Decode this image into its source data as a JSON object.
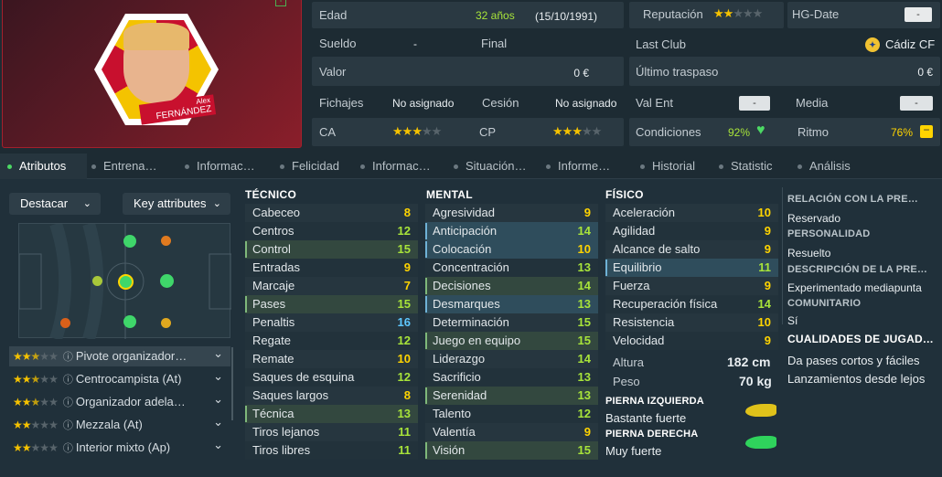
{
  "player": {
    "name_top": "Alex",
    "name_bottom": "FERNÁNDEZ"
  },
  "info": {
    "edad_label": "Edad",
    "edad_value": "32 años",
    "dob": "(15/10/1991)",
    "sueldo_label": "Sueldo",
    "sueldo_value": "-",
    "final_label": "Final",
    "valor_label": "Valor",
    "valor_value": "0 €",
    "fichajes_label": "Fichajes",
    "fichajes_value": "No asignado",
    "cesion_label": "Cesión",
    "cesion_value": "No asignado",
    "ca_label": "CA",
    "cp_label": "CP",
    "ca_stars": 3,
    "cp_stars": 3,
    "reputacion_label": "Reputación",
    "reputacion_stars": 2,
    "hgdate_label": "HG-Date",
    "hgdate_value": "-",
    "lastclub_label": "Last Club",
    "lastclub_value": "Cádiz CF",
    "traspaso_label": "Último traspaso",
    "traspaso_value": "0 €",
    "valent_label": "Val Ent",
    "valent_value": "-",
    "media_label": "Media",
    "media_value": "-",
    "condiciones_label": "Condiciones",
    "condiciones_value": "92%",
    "ritmo_label": "Ritmo",
    "ritmo_value": "76%"
  },
  "tabs": [
    "Atributos",
    "Entrena…",
    "Informac…",
    "Felicidad",
    "Informac…",
    "Situación…",
    "Informe…",
    "Historial",
    "Statistic",
    "Análisis"
  ],
  "left": {
    "destacar": "Destacar",
    "key_attributes": "Key attributes",
    "roles": [
      {
        "name": "Pivote organizador…",
        "stars": 2.5
      },
      {
        "name": "Centrocampista (At)",
        "stars": 2.5
      },
      {
        "name": "Organizador adela…",
        "stars": 2.5
      },
      {
        "name": "Mezzala (At)",
        "stars": 2
      },
      {
        "name": "Interior mixto (Ap)",
        "stars": 2
      }
    ]
  },
  "tecnico": {
    "title": "TÉCNICO",
    "rows": [
      {
        "name": "Cabeceo",
        "value": "8"
      },
      {
        "name": "Centros",
        "value": "12"
      },
      {
        "name": "Control",
        "value": "15"
      },
      {
        "name": "Entradas",
        "value": "9"
      },
      {
        "name": "Marcaje",
        "value": "7"
      },
      {
        "name": "Pases",
        "value": "15"
      },
      {
        "name": "Penaltis",
        "value": "16"
      },
      {
        "name": "Regate",
        "value": "12"
      },
      {
        "name": "Remate",
        "value": "10"
      },
      {
        "name": "Saques de esquina",
        "value": "12"
      },
      {
        "name": "Saques largos",
        "value": "8"
      },
      {
        "name": "Técnica",
        "value": "13"
      },
      {
        "name": "Tiros lejanos",
        "value": "11"
      },
      {
        "name": "Tiros libres",
        "value": "11"
      }
    ]
  },
  "mental": {
    "title": "MENTAL",
    "rows": [
      {
        "name": "Agresividad",
        "value": "9"
      },
      {
        "name": "Anticipación",
        "value": "14"
      },
      {
        "name": "Colocación",
        "value": "10"
      },
      {
        "name": "Concentración",
        "value": "13"
      },
      {
        "name": "Decisiones",
        "value": "14"
      },
      {
        "name": "Desmarques",
        "value": "13"
      },
      {
        "name": "Determinación",
        "value": "15"
      },
      {
        "name": "Juego en equipo",
        "value": "15"
      },
      {
        "name": "Liderazgo",
        "value": "14"
      },
      {
        "name": "Sacrificio",
        "value": "13"
      },
      {
        "name": "Serenidad",
        "value": "13"
      },
      {
        "name": "Talento",
        "value": "12"
      },
      {
        "name": "Valentía",
        "value": "9"
      },
      {
        "name": "Visión",
        "value": "15"
      }
    ]
  },
  "fisico": {
    "title": "FÍSICO",
    "rows": [
      {
        "name": "Aceleración",
        "value": "10"
      },
      {
        "name": "Agilidad",
        "value": "9"
      },
      {
        "name": "Alcance de salto",
        "value": "9"
      },
      {
        "name": "Equilibrio",
        "value": "11"
      },
      {
        "name": "Fuerza",
        "value": "9"
      },
      {
        "name": "Recuperación física",
        "value": "14"
      },
      {
        "name": "Resistencia",
        "value": "10"
      },
      {
        "name": "Velocidad",
        "value": "9"
      }
    ],
    "altura_label": "Altura",
    "altura_value": "182 cm",
    "peso_label": "Peso",
    "peso_value": "70 kg",
    "pie_izq_label": "PIERNA IZQUIERDA",
    "pie_izq_value": "Bastante fuerte",
    "pie_der_label": "PIERNA DERECHA",
    "pie_der_value": "Muy fuerte"
  },
  "side": {
    "relacion_label": "RELACIÓN CON LA PRE…",
    "relacion_value": "Reservado",
    "personalidad_label": "PERSONALIDAD",
    "personalidad_value": "Resuelto",
    "descripcion_label": "DESCRIPCIÓN DE LA PRE…",
    "descripcion_value": "Experimentado mediapunta",
    "comunitario_label": "COMUNITARIO",
    "comunitario_value": "Sí",
    "cualidades_label": "CUALIDADES DE JUGAD…",
    "cualidades": [
      "Da pases cortos y fáciles",
      "Lanzamientos desde lejos"
    ]
  },
  "colors": {
    "green_value": "#a8e43a",
    "yellow_value": "#ffd400",
    "cyan_value": "#5ec8ff",
    "highlight": "#2d5160"
  }
}
